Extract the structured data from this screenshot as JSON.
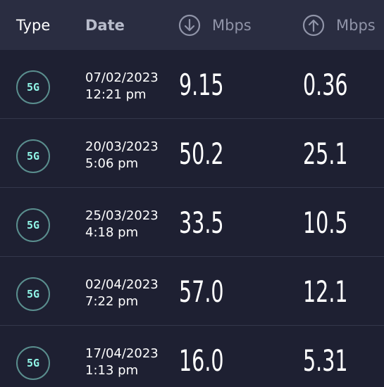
{
  "header": {
    "type_label": "Type",
    "date_label": "Date",
    "download_label": "Mbps",
    "download_icon": "arrow-down-circle-icon",
    "upload_label": "Mbps",
    "upload_icon": "arrow-up-circle-icon"
  },
  "colors": {
    "background": "#1e2032",
    "header_background": "#2a2d41",
    "badge_text": "#8ff4e6",
    "badge_border": "#5a8e8e"
  },
  "results": [
    {
      "type": "5G",
      "date": "07/02/2023",
      "time": "12:21 pm",
      "download": "9.15",
      "upload": "0.36"
    },
    {
      "type": "5G",
      "date": "20/03/2023",
      "time": "5:06 pm",
      "download": "50.2",
      "upload": "25.1"
    },
    {
      "type": "5G",
      "date": "25/03/2023",
      "time": "4:18 pm",
      "download": "33.5",
      "upload": "10.5"
    },
    {
      "type": "5G",
      "date": "02/04/2023",
      "time": "7:22 pm",
      "download": "57.0",
      "upload": "12.1"
    },
    {
      "type": "5G",
      "date": "17/04/2023",
      "time": "1:13 pm",
      "download": "16.0",
      "upload": "5.31"
    }
  ]
}
